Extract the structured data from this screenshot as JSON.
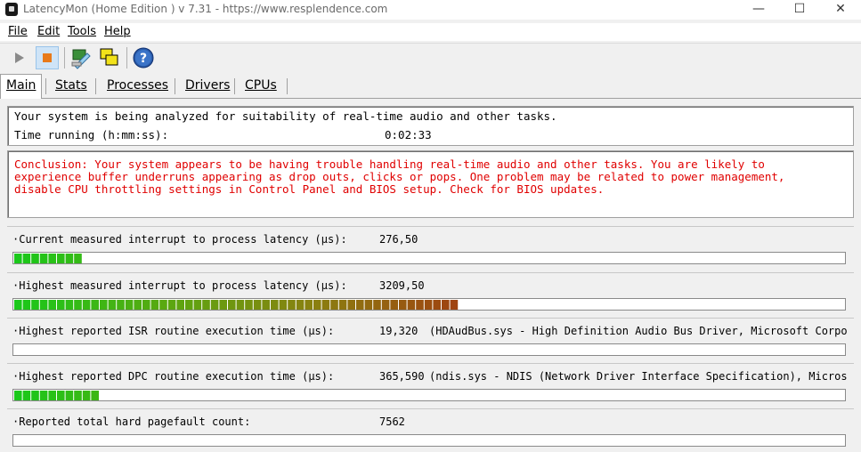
{
  "window": {
    "title": "LatencyMon  (Home Edition )  v 7.31 - https://www.resplendence.com",
    "min_glyph": "—",
    "max_glyph": "☐",
    "close_glyph": "✕"
  },
  "menu": [
    "File",
    "Edit",
    "Tools",
    "Help"
  ],
  "toolbar": {
    "buttons": [
      "play-icon",
      "stop-icon",
      "monitor-icon",
      "windows-icon",
      "help-icon"
    ],
    "colors": {
      "stop": "#e87a1a",
      "help": "#2a5caa"
    }
  },
  "tabs": [
    "Main",
    "Stats",
    "Processes",
    "Drivers",
    "CPUs"
  ],
  "status": {
    "analyzing": "Your system is being analyzed for suitability of real-time audio and other tasks.",
    "time_label": "Time running (h:mm:ss):",
    "time_value": "0:02:33"
  },
  "conclusion": {
    "line1": "Conclusion: Your system appears to be having trouble handling real-time audio and other tasks. You are likely to",
    "line2": "experience buffer underruns appearing as drop outs, clicks or pops. One problem may be related to power management,",
    "line3": "disable CPU throttling settings in Control Panel and BIOS setup. Check for BIOS updates.",
    "color": "#e00000"
  },
  "metrics": [
    {
      "label": "·Current measured interrupt to process latency (µs):",
      "value": "276,50",
      "desc": "",
      "segments": 8
    },
    {
      "label": "·Highest measured interrupt to process latency (µs):",
      "value": "3209,50",
      "desc": "",
      "segments": 52
    },
    {
      "label": "·Highest reported ISR routine execution time (µs):",
      "value": "19,320",
      "desc": "(HDAudBus.sys - High Definition Audio Bus Driver, Microsoft Corporation)",
      "segments": 0
    },
    {
      "label": "·Highest reported DPC routine execution time (µs):",
      "value": "365,590",
      "desc": "(ndis.sys - NDIS (Network Driver Interface Specification), Microsoft Corporation)",
      "segments": 10
    },
    {
      "label": "·Reported total hard pagefault count:",
      "value": "7562",
      "desc": "",
      "segments": 0
    }
  ]
}
